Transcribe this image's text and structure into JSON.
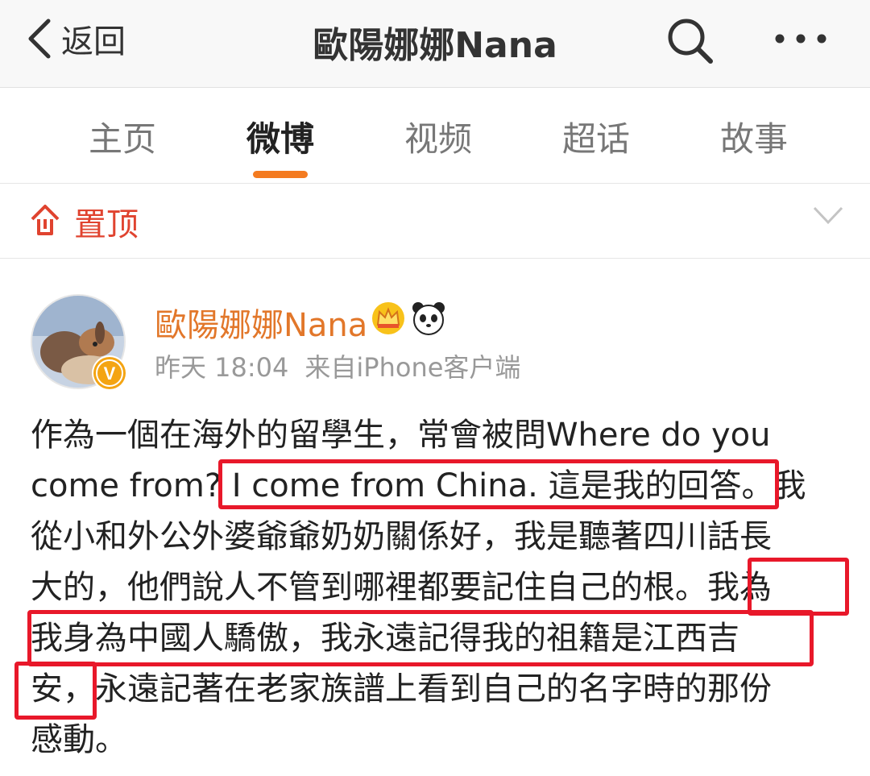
{
  "navbar": {
    "back_label": "返回",
    "title": "歐陽娜娜Nana",
    "search_icon": "search-icon",
    "more_icon": "more-icon"
  },
  "tabs": [
    {
      "label": "主页",
      "active": false
    },
    {
      "label": "微博",
      "active": true
    },
    {
      "label": "视频",
      "active": false
    },
    {
      "label": "超话",
      "active": false
    },
    {
      "label": "故事",
      "active": false
    }
  ],
  "pinned": {
    "label": "置顶",
    "icon": "pin-top-icon",
    "chevron": "chevron-down-icon"
  },
  "post": {
    "author": "歐陽娜娜Nana",
    "time": "昨天 18:04",
    "source": "来自iPhone客户端",
    "badges": [
      "crown-icon",
      "panda-icon"
    ],
    "verified_badge": "V",
    "lines": [
      "作為一個在海外的留學生，常會被問Where do you",
      "come from? I come from China. 這是我的回答。我",
      "從小和外公外婆爺爺奶奶關係好，我是聽著四川話長",
      "大的，他們說人不管到哪裡都要記住自己的根。我為",
      "我身為中國人驕傲，我永遠記得我的祖籍是江西吉",
      "安，永遠記著在老家族譜上看到自己的名字時的那份",
      "感動。"
    ],
    "highlight_color": "#e8182a"
  },
  "colors": {
    "accent": "#f47b20",
    "author": "#e2772a",
    "pinned": "#e0432f"
  }
}
